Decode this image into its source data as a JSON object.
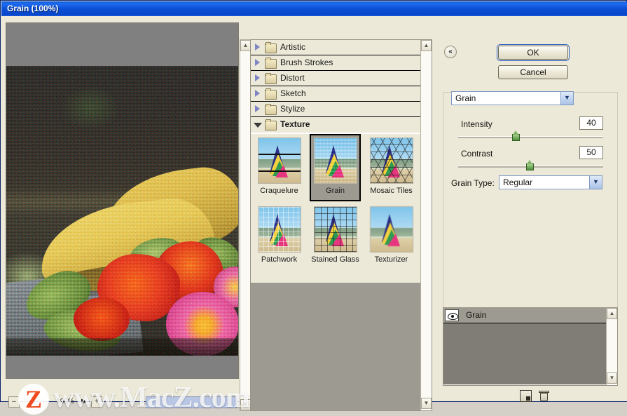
{
  "window": {
    "title": "Grain (100%)"
  },
  "preview": {
    "zoom_out_label": "–",
    "zoom_in_label": "+",
    "zoom_level": "100%",
    "arrow_icon": "play-icon"
  },
  "browser": {
    "categories": [
      {
        "label": "Artistic",
        "expanded": false
      },
      {
        "label": "Brush Strokes",
        "expanded": false
      },
      {
        "label": "Distort",
        "expanded": false
      },
      {
        "label": "Sketch",
        "expanded": false
      },
      {
        "label": "Stylize",
        "expanded": false
      },
      {
        "label": "Texture",
        "expanded": true
      }
    ],
    "thumbnails": [
      {
        "label": "Craquelure",
        "selected": false
      },
      {
        "label": "Grain",
        "selected": true
      },
      {
        "label": "Mosaic Tiles",
        "selected": false
      },
      {
        "label": "Patchwork",
        "selected": false
      },
      {
        "label": "Stained Glass",
        "selected": false
      },
      {
        "label": "Texturizer",
        "selected": false
      }
    ]
  },
  "settings": {
    "collapse_icon": "«",
    "ok_label": "OK",
    "cancel_label": "Cancel",
    "filter_name": "Grain",
    "dropdown_arrow": "▼",
    "intensity_label": "Intensity",
    "intensity_value": "40",
    "contrast_label": "Contrast",
    "contrast_value": "50",
    "grain_type_label": "Grain Type:",
    "grain_type_value": "Regular"
  },
  "layers": {
    "items": [
      {
        "name": "Grain",
        "visible": true
      }
    ],
    "new_layer_icon": "new-effect-layer-icon",
    "delete_icon": "trash-icon"
  },
  "watermark": {
    "text": "www.MacZ.com",
    "badge_letter": "Z"
  },
  "colors": {
    "titlebar": "#0a4fd0",
    "panel": "#ece9d8",
    "selection": "#9d9a92",
    "accent": "#2b5fc4",
    "slider": "#4f8f3e"
  }
}
